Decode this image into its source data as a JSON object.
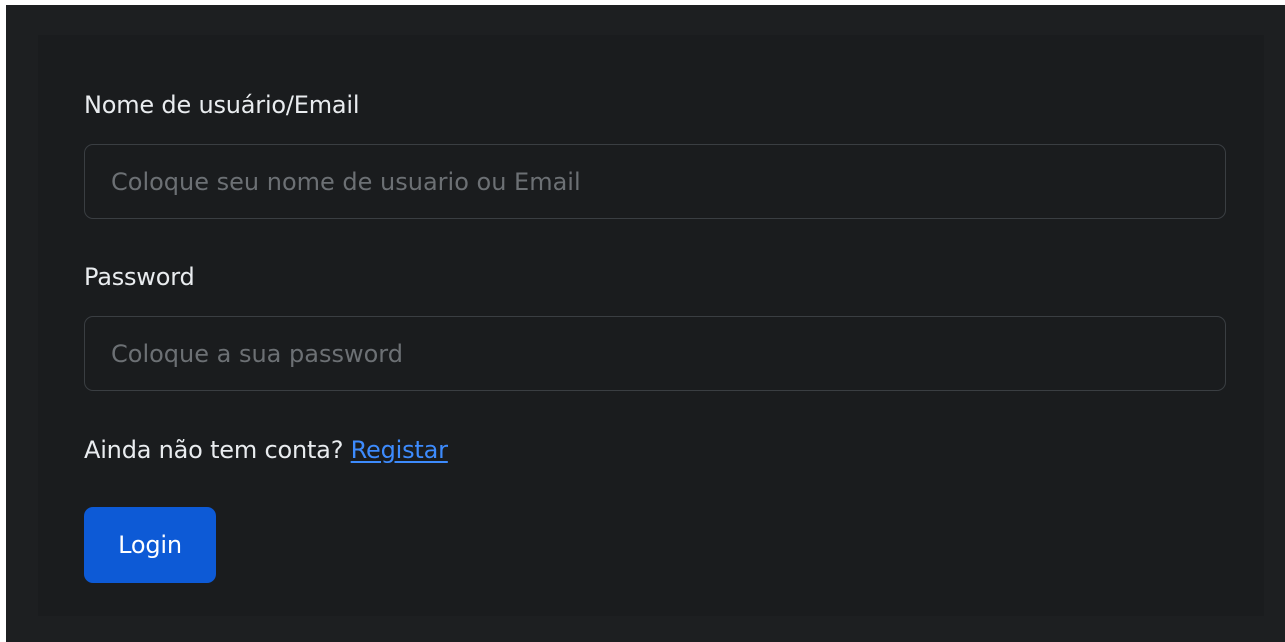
{
  "form": {
    "username_label": "Nome de usuário/Email",
    "username_value": "",
    "username_placeholder": "Coloque seu nome de usuario ou Email",
    "password_label": "Password",
    "password_value": "",
    "password_placeholder": "Coloque a sua password",
    "register_prompt": "Ainda não tem conta?",
    "register_link": "Registar",
    "login_button": "Login"
  },
  "colors": {
    "background": "#1a1c1e",
    "text": "#e9ecef",
    "placeholder": "#6c7074",
    "input_border": "#3a3e42",
    "link": "#3d8bfd",
    "primary_button": "#0d5ad6"
  }
}
